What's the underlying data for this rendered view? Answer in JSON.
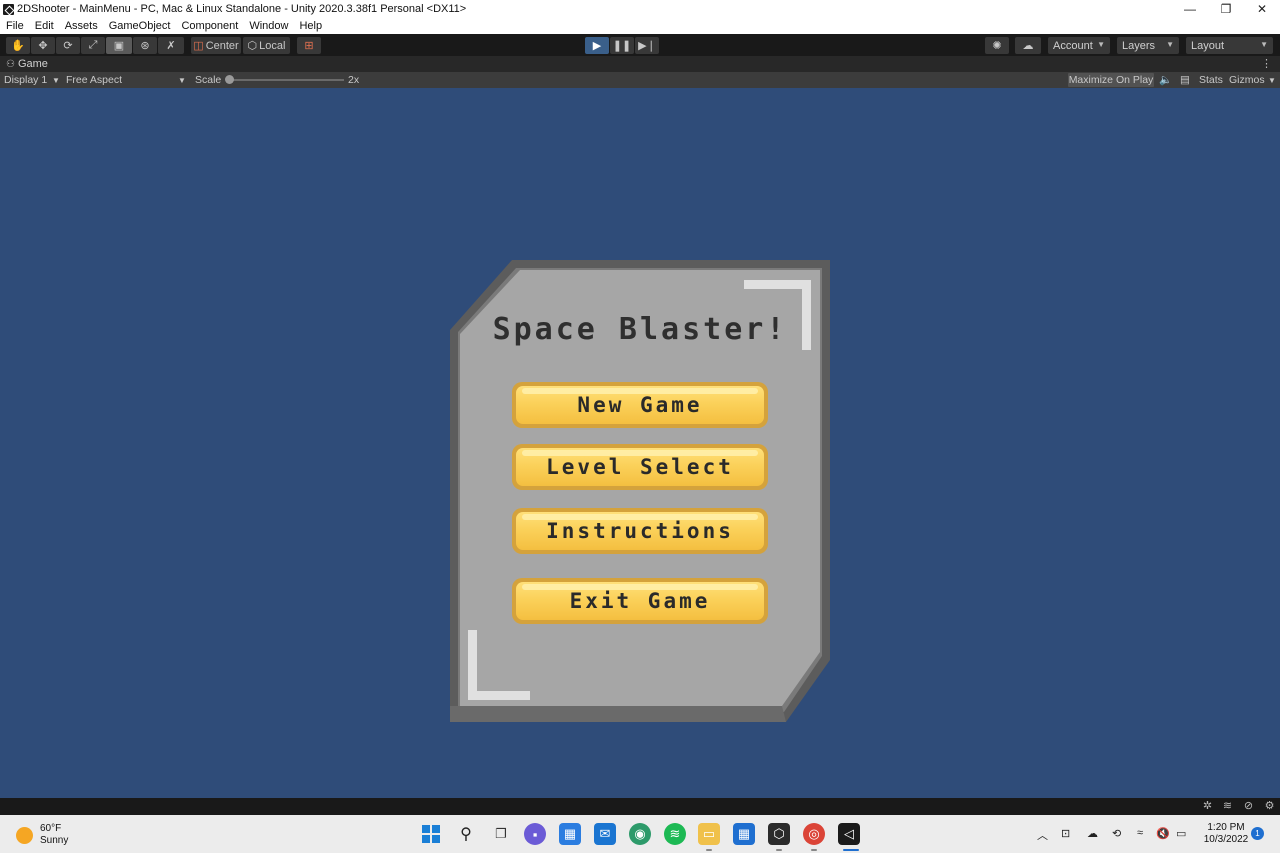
{
  "window": {
    "title": "2DShooter - MainMenu - PC, Mac & Linux Standalone - Unity 2020.3.38f1 Personal <DX11>",
    "controls": [
      "—",
      "❐",
      "✕"
    ]
  },
  "menubar": {
    "items": [
      "File",
      "Edit",
      "Assets",
      "GameObject",
      "Component",
      "Window",
      "Help"
    ]
  },
  "toolbar": {
    "pivot_label": "Center",
    "space_label": "Local",
    "account_label": "Account",
    "layers_label": "Layers",
    "layout_label": "Layout"
  },
  "game_view": {
    "tab_label": "Game",
    "display_label": "Display 1",
    "aspect_label": "Free Aspect",
    "scale_label": "Scale",
    "scale_value": "2x",
    "maximize_label": "Maximize On Play",
    "stats_label": "Stats",
    "gizmos_label": "Gizmos",
    "background_color": "#2f4c79"
  },
  "game_menu": {
    "title": "Space Blaster!",
    "buttons": {
      "new_game": "New Game",
      "level_select": "Level Select",
      "instructions": "Instructions",
      "exit_game": "Exit Game"
    },
    "button_color": "#fbd15a",
    "panel_color": "#a6a6a6"
  },
  "taskbar": {
    "weather_temp": "60°F",
    "weather_desc": "Sunny",
    "time": "1:20 PM",
    "date": "10/3/2022",
    "notification_count": "1"
  }
}
